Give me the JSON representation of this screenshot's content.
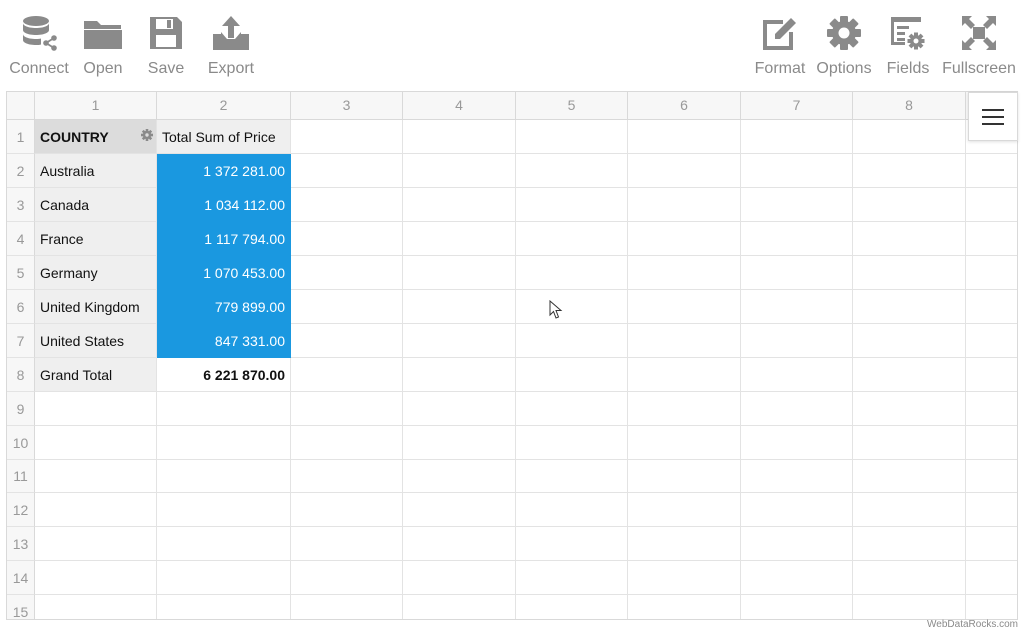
{
  "toolbar": {
    "left": [
      {
        "label": "Connect",
        "icon": "database-connect-icon"
      },
      {
        "label": "Open",
        "icon": "folder-icon"
      },
      {
        "label": "Save",
        "icon": "floppy-disk-icon"
      },
      {
        "label": "Export",
        "icon": "export-icon"
      }
    ],
    "right": [
      {
        "label": "Format",
        "icon": "format-pencil-icon"
      },
      {
        "label": "Options",
        "icon": "gear-icon"
      },
      {
        "label": "Fields",
        "icon": "fields-icon"
      },
      {
        "label": "Fullscreen",
        "icon": "fullscreen-icon"
      }
    ]
  },
  "grid": {
    "column_numbers": [
      "1",
      "2",
      "3",
      "4",
      "5",
      "6",
      "7",
      "8"
    ],
    "row_numbers": [
      "1",
      "2",
      "3",
      "4",
      "5",
      "6",
      "7",
      "8",
      "9",
      "10",
      "11",
      "12",
      "13",
      "14",
      "15"
    ],
    "row_field_header": "COUNTRY",
    "measure_header": "Total Sum of Price",
    "rows": [
      {
        "country": "Australia",
        "value": "1 372 281.00"
      },
      {
        "country": "Canada",
        "value": "1 034 112.00"
      },
      {
        "country": "France",
        "value": "1 117 794.00"
      },
      {
        "country": "Germany",
        "value": "1 070 453.00"
      },
      {
        "country": "United Kingdom",
        "value": "779 899.00"
      },
      {
        "country": "United States",
        "value": "847 331.00"
      }
    ],
    "grand_total_label": "Grand Total",
    "grand_total_value": "6 221 870.00",
    "selection_color": "#1a98e0"
  },
  "watermark": "WebDataRocks.com",
  "colors": {
    "icon": "#8a8a8a",
    "selection": "#1a98e0"
  }
}
